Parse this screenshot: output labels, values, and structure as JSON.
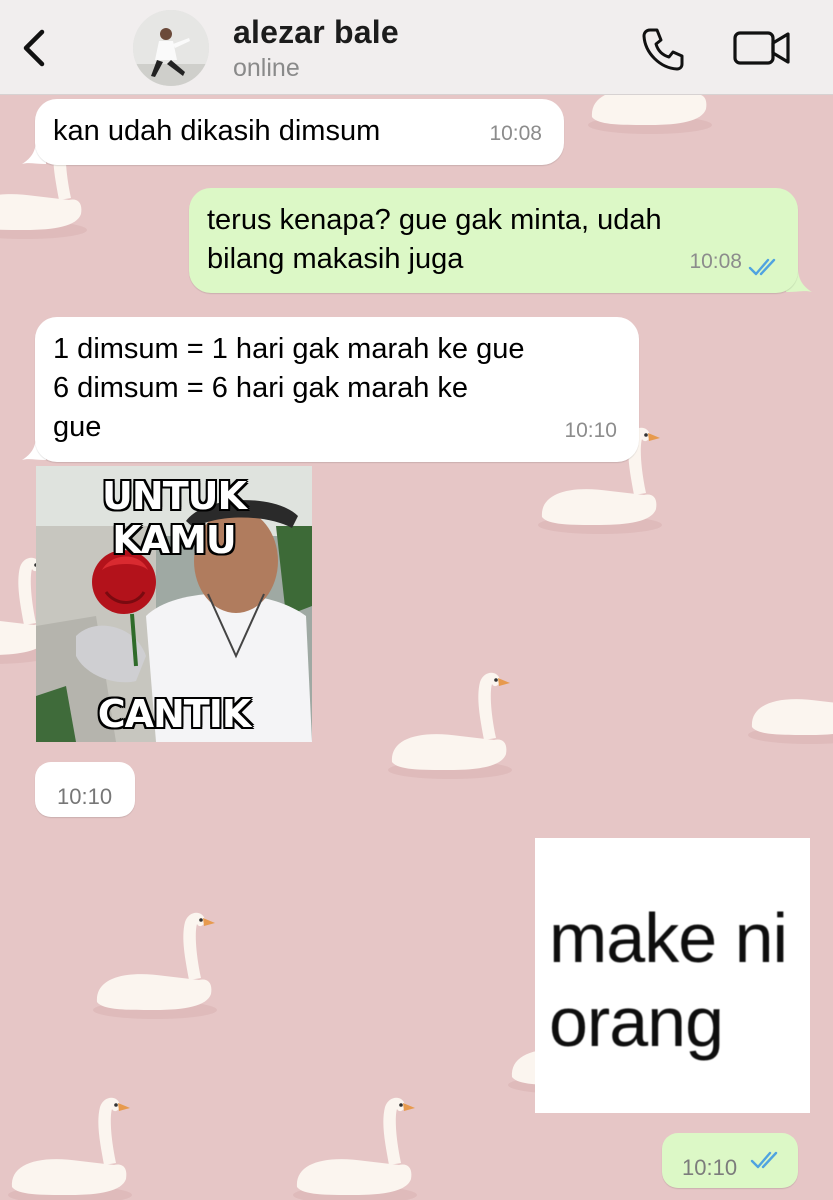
{
  "header": {
    "contact_name": "alezar bale",
    "status": "online"
  },
  "messages": [
    {
      "direction": "incoming",
      "text": "kan udah dikasih dimsum",
      "time": "10:08"
    },
    {
      "direction": "outgoing",
      "text_lines": [
        "terus kenapa? gue gak minta, udah",
        "bilang makasih juga"
      ],
      "time": "10:08",
      "read": true
    },
    {
      "direction": "incoming",
      "text_lines": [
        "1 dimsum = 1 hari gak marah ke gue",
        "6 dimsum = 6 hari gak marah ke",
        "gue"
      ],
      "time": "10:10"
    },
    {
      "direction": "incoming",
      "type": "image",
      "caption_top": "UNTUK KAMU",
      "caption_bottom": "CANTIK",
      "time": "10:10"
    },
    {
      "direction": "outgoing",
      "type": "image",
      "image_text_lines": [
        "make ni",
        "orang"
      ],
      "time": "10:10",
      "read": true
    }
  ],
  "colors": {
    "incoming_bubble": "#ffffff",
    "outgoing_bubble": "#dcf8c6",
    "read_ticks": "#4fa3e0",
    "wallpaper": "#e6c6c6"
  },
  "icons": [
    "chevron-left-icon",
    "phone-icon",
    "video-camera-icon",
    "double-check-icon"
  ]
}
